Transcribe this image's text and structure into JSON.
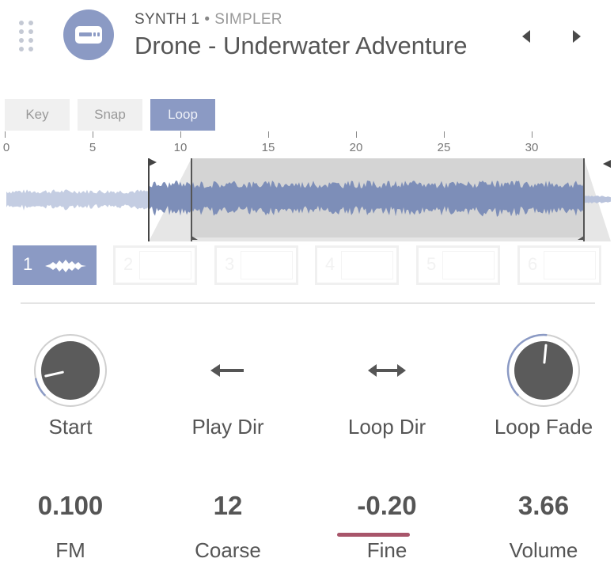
{
  "header": {
    "device_label": "SYNTH 1",
    "separator": "•",
    "device_type": "SIMPLER",
    "preset_name": "Drone - Underwater Adventure",
    "device_icon": "sampler-card-icon",
    "prev_icon": "triangle-left-icon",
    "next_icon": "triangle-right-icon"
  },
  "tabs": [
    {
      "label": "Key",
      "active": false
    },
    {
      "label": "Snap",
      "active": false
    },
    {
      "label": "Loop",
      "active": true
    }
  ],
  "ruler": {
    "ticks": [
      "0",
      "5",
      "10",
      "15",
      "20",
      "25",
      "30"
    ]
  },
  "waveform": {
    "start_marker": true,
    "loop_region": true,
    "end_marker": true
  },
  "slots": [
    {
      "label": "1",
      "active": true,
      "has_sample": true
    },
    {
      "label": "2",
      "active": false
    },
    {
      "label": "3",
      "active": false
    },
    {
      "label": "4",
      "active": false
    },
    {
      "label": "5",
      "active": false
    },
    {
      "label": "6",
      "active": false
    }
  ],
  "controls": [
    {
      "label": "Start",
      "type": "knob",
      "level": 0.12
    },
    {
      "label": "Play Dir",
      "type": "direction",
      "icon": "arrow-left-icon"
    },
    {
      "label": "Loop Dir",
      "type": "direction",
      "icon": "arrow-left-right-icon"
    },
    {
      "label": "Loop Fade",
      "type": "knob",
      "level": 0.52
    }
  ],
  "params": [
    {
      "label": "FM",
      "value": "0.100"
    },
    {
      "label": "Coarse",
      "value": "12"
    },
    {
      "label": "Fine",
      "value": "-0.20",
      "selected": true
    },
    {
      "label": "Volume",
      "value": "3.66"
    }
  ],
  "colors": {
    "accent": "#8b9ac4",
    "selected_underline": "#a8556a",
    "waveform": "#7d8eb8"
  }
}
